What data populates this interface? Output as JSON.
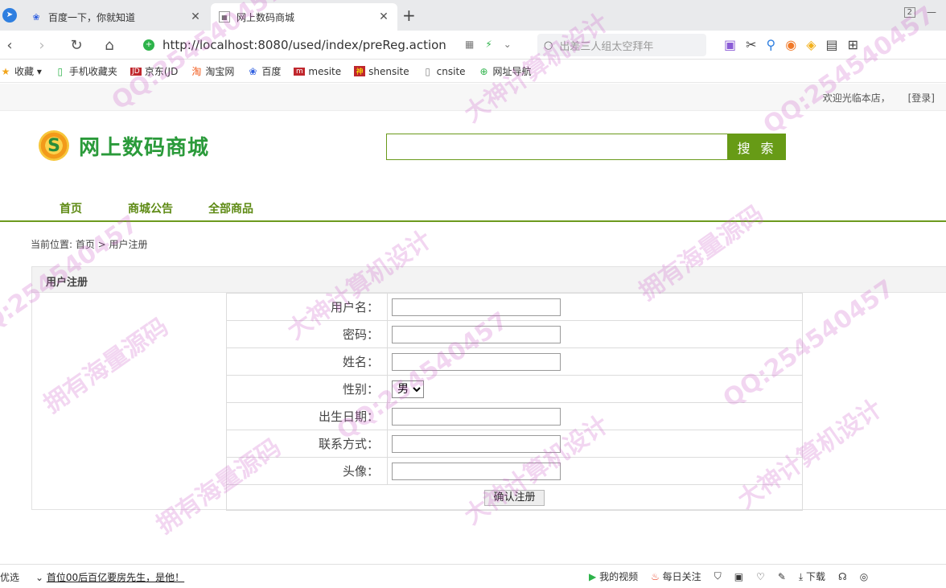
{
  "browser": {
    "tabs": [
      {
        "title": "百度一下，你就知道",
        "icon": "baidu-paw-icon",
        "active": false
      },
      {
        "title": "网上数码商城",
        "icon": "page-icon",
        "active": true
      }
    ],
    "tab_count": "2",
    "url": "http://localhost:8080/used/index/preReg.action",
    "search_placeholder": "出差三人组太空拜年",
    "bookmarks": [
      {
        "label": "收藏",
        "icon": "star-icon"
      },
      {
        "label": "手机收藏夹",
        "icon": "phone-icon"
      },
      {
        "label": "京东(JD",
        "icon": "jd-icon"
      },
      {
        "label": "淘宝网",
        "icon": "taobao-icon"
      },
      {
        "label": "百度",
        "icon": "baidu-paw-icon"
      },
      {
        "label": "mesite",
        "icon": "site-icon"
      },
      {
        "label": "shensite",
        "icon": "site-icon"
      },
      {
        "label": "cnsite",
        "icon": "page-icon"
      },
      {
        "label": "网址导航",
        "icon": "nav-icon"
      }
    ]
  },
  "header": {
    "welcome": "欢迎光临本店，",
    "login": "[登录]",
    "site_name": "网上数码商城",
    "search_button": "搜 索"
  },
  "nav": [
    "首页",
    "商城公告",
    "全部商品"
  ],
  "breadcrumb": "当前位置: 首页 > 用户注册",
  "form": {
    "title": "用户注册",
    "labels": {
      "username": "用户名：",
      "password": "密码：",
      "realname": "姓名：",
      "gender": "性别：",
      "birthday": "出生日期：",
      "contact": "联系方式：",
      "avatar": "头像："
    },
    "gender_value": "男",
    "submit": "确认注册"
  },
  "statusbar": {
    "left_cut": "优选",
    "headline": "首位00后百亿要房先生，是他！",
    "video": "我的视频",
    "daily": "每日关注",
    "download": "下载"
  },
  "watermarks": [
    "QQ:254540457",
    "大神计算机设计",
    "拥有海量源码"
  ]
}
